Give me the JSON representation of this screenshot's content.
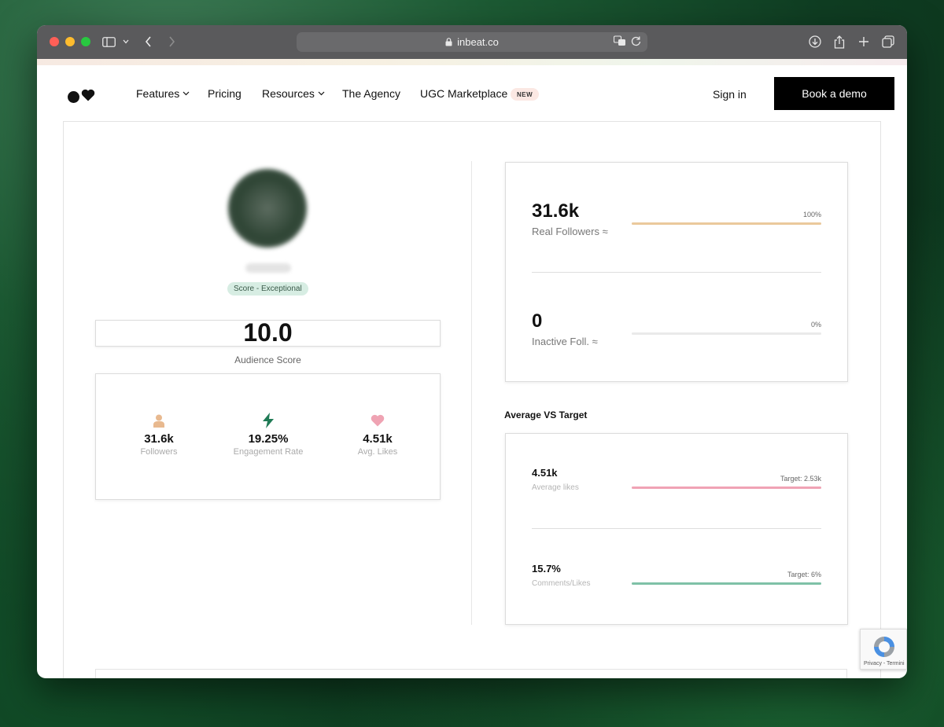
{
  "browser": {
    "url": "inbeat.co"
  },
  "nav": {
    "items": [
      "Features",
      "Pricing",
      "Resources",
      "The Agency",
      "UGC Marketplace"
    ],
    "new_badge": "NEW",
    "signin": "Sign in",
    "demo": "Book a demo"
  },
  "profile": {
    "score_pill": "Score - Exceptional",
    "audience_score": "10.0",
    "audience_label": "Audience Score"
  },
  "stats": [
    {
      "icon": "person-icon",
      "value": "31.6k",
      "label": "Followers",
      "color": "#e8b98f"
    },
    {
      "icon": "lightning-icon",
      "value": "19.25%",
      "label": "Engagement Rate",
      "color": "#1f7a55"
    },
    {
      "icon": "heart-icon",
      "value": "4.51k",
      "label": "Avg. Likes",
      "color": "#efa3b3"
    }
  ],
  "followers_card": {
    "real": {
      "value": "31.6k",
      "label": "Real Followers ≈",
      "percent": "100%",
      "fill": 1.0,
      "color": "#ebc99c"
    },
    "inactive": {
      "value": "0",
      "label": "Inactive Foll. ≈",
      "percent": "0%",
      "fill": 0.0,
      "color": "#e5e5e5"
    }
  },
  "target_section": {
    "title": "Average VS Target",
    "likes": {
      "value": "4.51k",
      "label": "Average likes",
      "target": "Target: 2.53k",
      "fill": 1.0,
      "color": "#f0a3b5"
    },
    "comments": {
      "value": "15.7%",
      "label": "Comments/Likes",
      "target": "Target: 6%",
      "fill": 1.0,
      "color": "#7fc1a7"
    }
  },
  "recaptcha": {
    "text": "Privacy - Termini"
  }
}
